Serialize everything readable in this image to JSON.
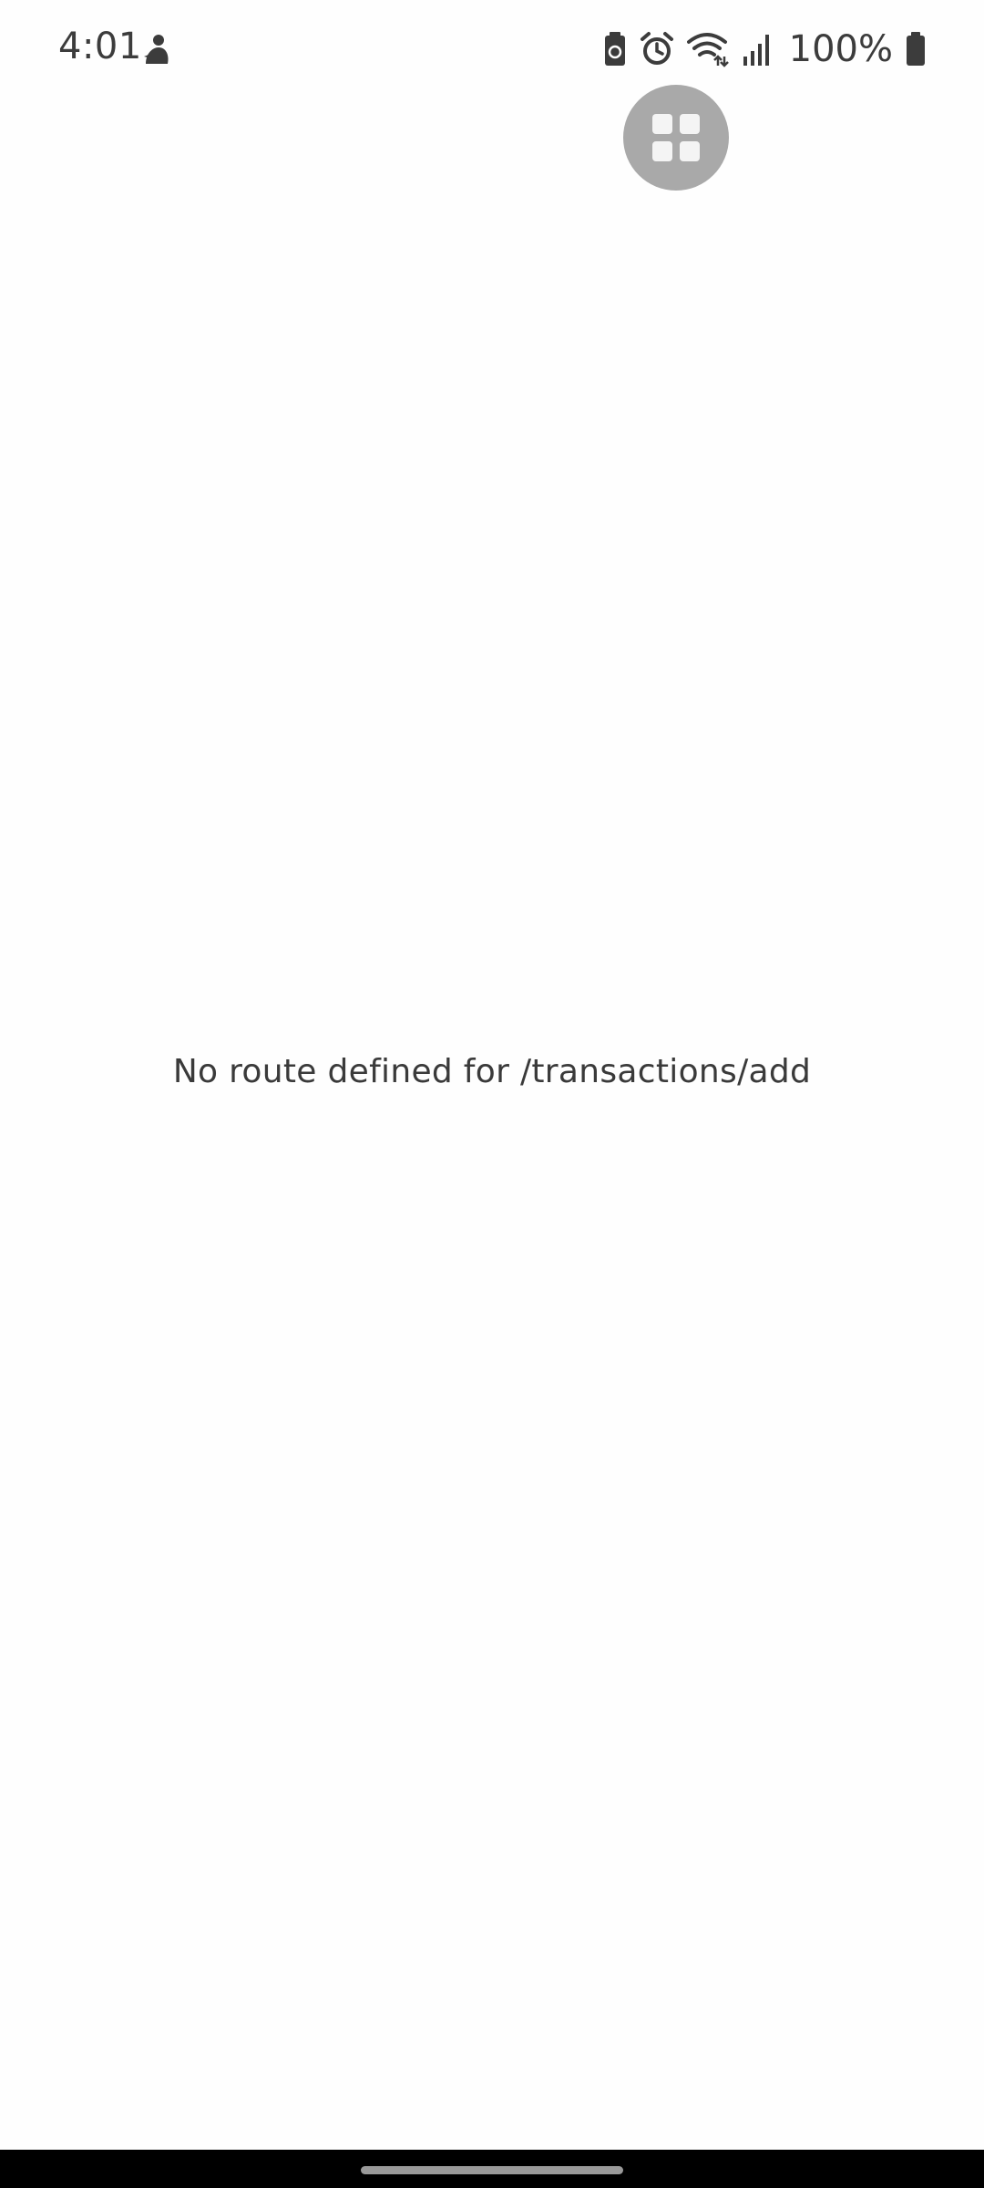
{
  "status_bar": {
    "time": "4:01",
    "battery_percent": "100%",
    "icons": [
      "app-notification-icon",
      "battery-saver-icon",
      "alarm-icon",
      "wifi-icon",
      "signal-icon",
      "battery-icon"
    ]
  },
  "floating_button": {
    "icon": "grid-icon"
  },
  "main": {
    "message": "No route defined for /transactions/add"
  },
  "colors": {
    "background": "#fefefe",
    "text": "#3a3a3a",
    "floating_button": "#a9a9a9",
    "nav_bar": "#000000"
  }
}
